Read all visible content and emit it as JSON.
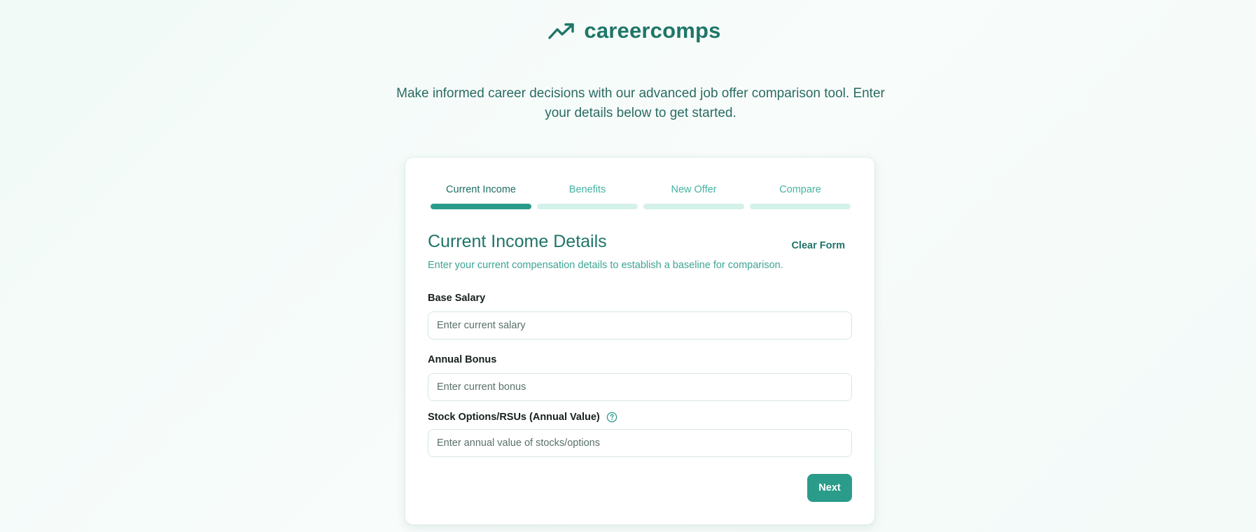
{
  "brand": {
    "name": "careercomps",
    "icon": "trending-up-icon",
    "color": "#1f7668"
  },
  "tagline": "Make informed career decisions with our advanced job offer comparison tool. Enter your details below to get started.",
  "steps": [
    {
      "label": "Current Income",
      "active": true
    },
    {
      "label": "Benefits",
      "active": false
    },
    {
      "label": "New Offer",
      "active": false
    },
    {
      "label": "Compare",
      "active": false
    }
  ],
  "form": {
    "title": "Current Income Details",
    "clear_label": "Clear Form",
    "description": "Enter your current compensation details to establish a baseline for comparison.",
    "fields": {
      "base_salary": {
        "label": "Base Salary",
        "value": "",
        "placeholder": "Enter current salary"
      },
      "annual_bonus": {
        "label": "Annual Bonus",
        "value": "",
        "placeholder": "Enter current bonus"
      },
      "stock_options": {
        "label": "Stock Options/RSUs (Annual Value)",
        "value": "",
        "placeholder": "Enter annual value of stocks/options",
        "help_icon": "help-circle-icon"
      }
    },
    "next_label": "Next"
  },
  "colors": {
    "accent": "#2b9b8a",
    "accent_dark": "#1f7468",
    "step_inactive": "#d4f1ea"
  }
}
